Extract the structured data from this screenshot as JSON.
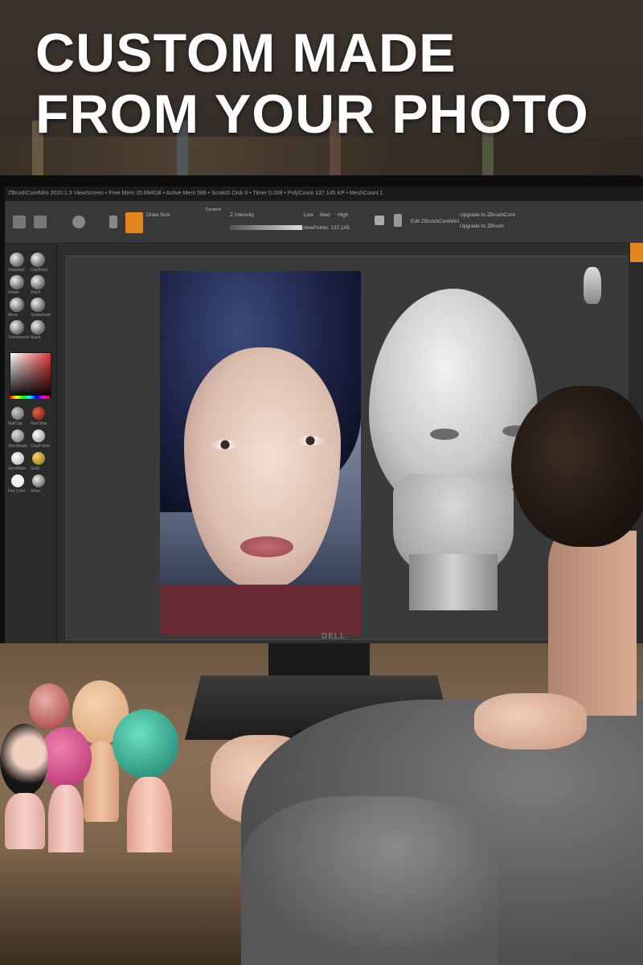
{
  "headline": {
    "line1": "CUSTOM MADE",
    "line2": "FROM YOUR PHOTO"
  },
  "software": {
    "titlebar_text": "ZBrushCoreMini 2020.1.3 ViewScreen  • Free Mem 15.694GB • Active Mem 589 • Scratch Disk 0 • Timer 0.008 • PolyCount 137.145 KP • MeshCount 1",
    "draw_size_label": "Draw Size",
    "dynamic_label": "Dynamic",
    "intensity_label": "Z Intensity",
    "low_label": "Low",
    "med_label": "Med",
    "high_label": "High",
    "active_points_label": "ActivePoints: 137,145",
    "edit_label": "Edit ZBrushCoreMini",
    "upgrade_label_1": "Upgrade to ZBrushCore",
    "upgrade_label_2": "Upgrade to ZBrush",
    "brush_labels": [
      "Standard",
      "ClayBuild",
      "Inflate",
      "Pinch",
      "Move",
      "Snakehook",
      "TrimSmooth",
      "Slash"
    ],
    "material_labels": [
      "MatCap",
      "Red Wax",
      "SkinShade",
      "ClayPolish",
      "SkinMatte",
      "Gold",
      "Flat Color",
      "Silver"
    ],
    "monitor_brand": "DELL"
  },
  "colors": {
    "accent_orange": "#e4861e",
    "ui_dark": "#2e2e2e",
    "headline_text": "#ffffff"
  },
  "icons": [
    "draw-icon",
    "brush-sphere-icon",
    "color-picker-icon",
    "material-sphere-icon",
    "head-preview-icon"
  ]
}
